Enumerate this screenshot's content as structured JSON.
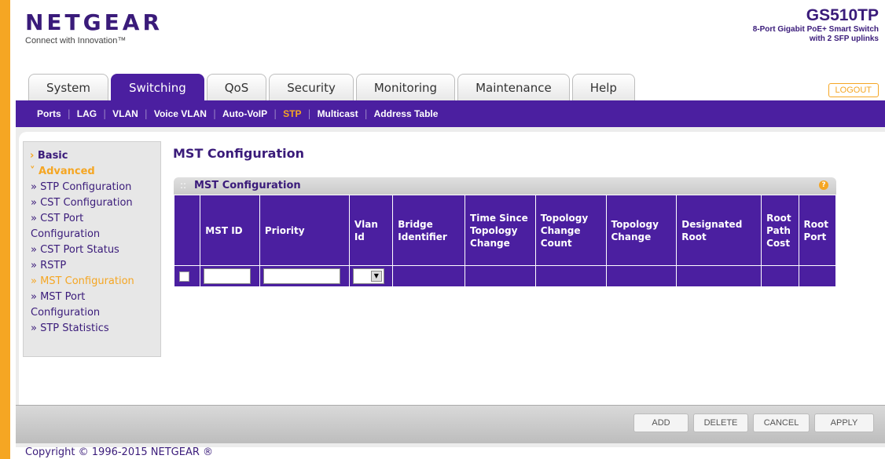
{
  "brand": {
    "logo": "NETGEAR",
    "tagline": "Connect with Innovation™"
  },
  "device": {
    "model": "GS510TP",
    "description": "8-Port Gigabit PoE+ Smart Switch\nwith 2 SFP uplinks"
  },
  "tabs": [
    "System",
    "Switching",
    "QoS",
    "Security",
    "Monitoring",
    "Maintenance",
    "Help"
  ],
  "active_tab": "Switching",
  "logout_label": "LOGOUT",
  "subnav": [
    "Ports",
    "LAG",
    "VLAN",
    "Voice VLAN",
    "Auto-VoIP",
    "STP",
    "Multicast",
    "Address Table"
  ],
  "active_subnav": "STP",
  "sidebar": {
    "basic": "Basic",
    "advanced": "Advanced",
    "items": [
      "STP Configuration",
      "CST Configuration",
      "CST Port Configuration",
      "CST Port Status",
      "RSTP",
      "MST Configuration",
      "MST Port Configuration",
      "STP Statistics"
    ],
    "active_item": "MST Configuration"
  },
  "page_title": "MST Configuration",
  "panel_title": "MST Configuration",
  "table": {
    "headers": [
      "MST ID",
      "Priority",
      "Vlan Id",
      "Bridge Identifier",
      "Time Since Topology Change",
      "Topology Change Count",
      "Topology Change",
      "Designated Root",
      "Root Path Cost",
      "Root Port"
    ],
    "row": {
      "mst_id": "",
      "priority": "",
      "vlan_id": ""
    }
  },
  "buttons": {
    "add": "ADD",
    "delete": "DELETE",
    "cancel": "CANCEL",
    "apply": "APPLY"
  },
  "copyright": "Copyright © 1996-2015 NETGEAR ®",
  "colors": {
    "purple": "#4b1fa0",
    "orange": "#f5a623"
  }
}
